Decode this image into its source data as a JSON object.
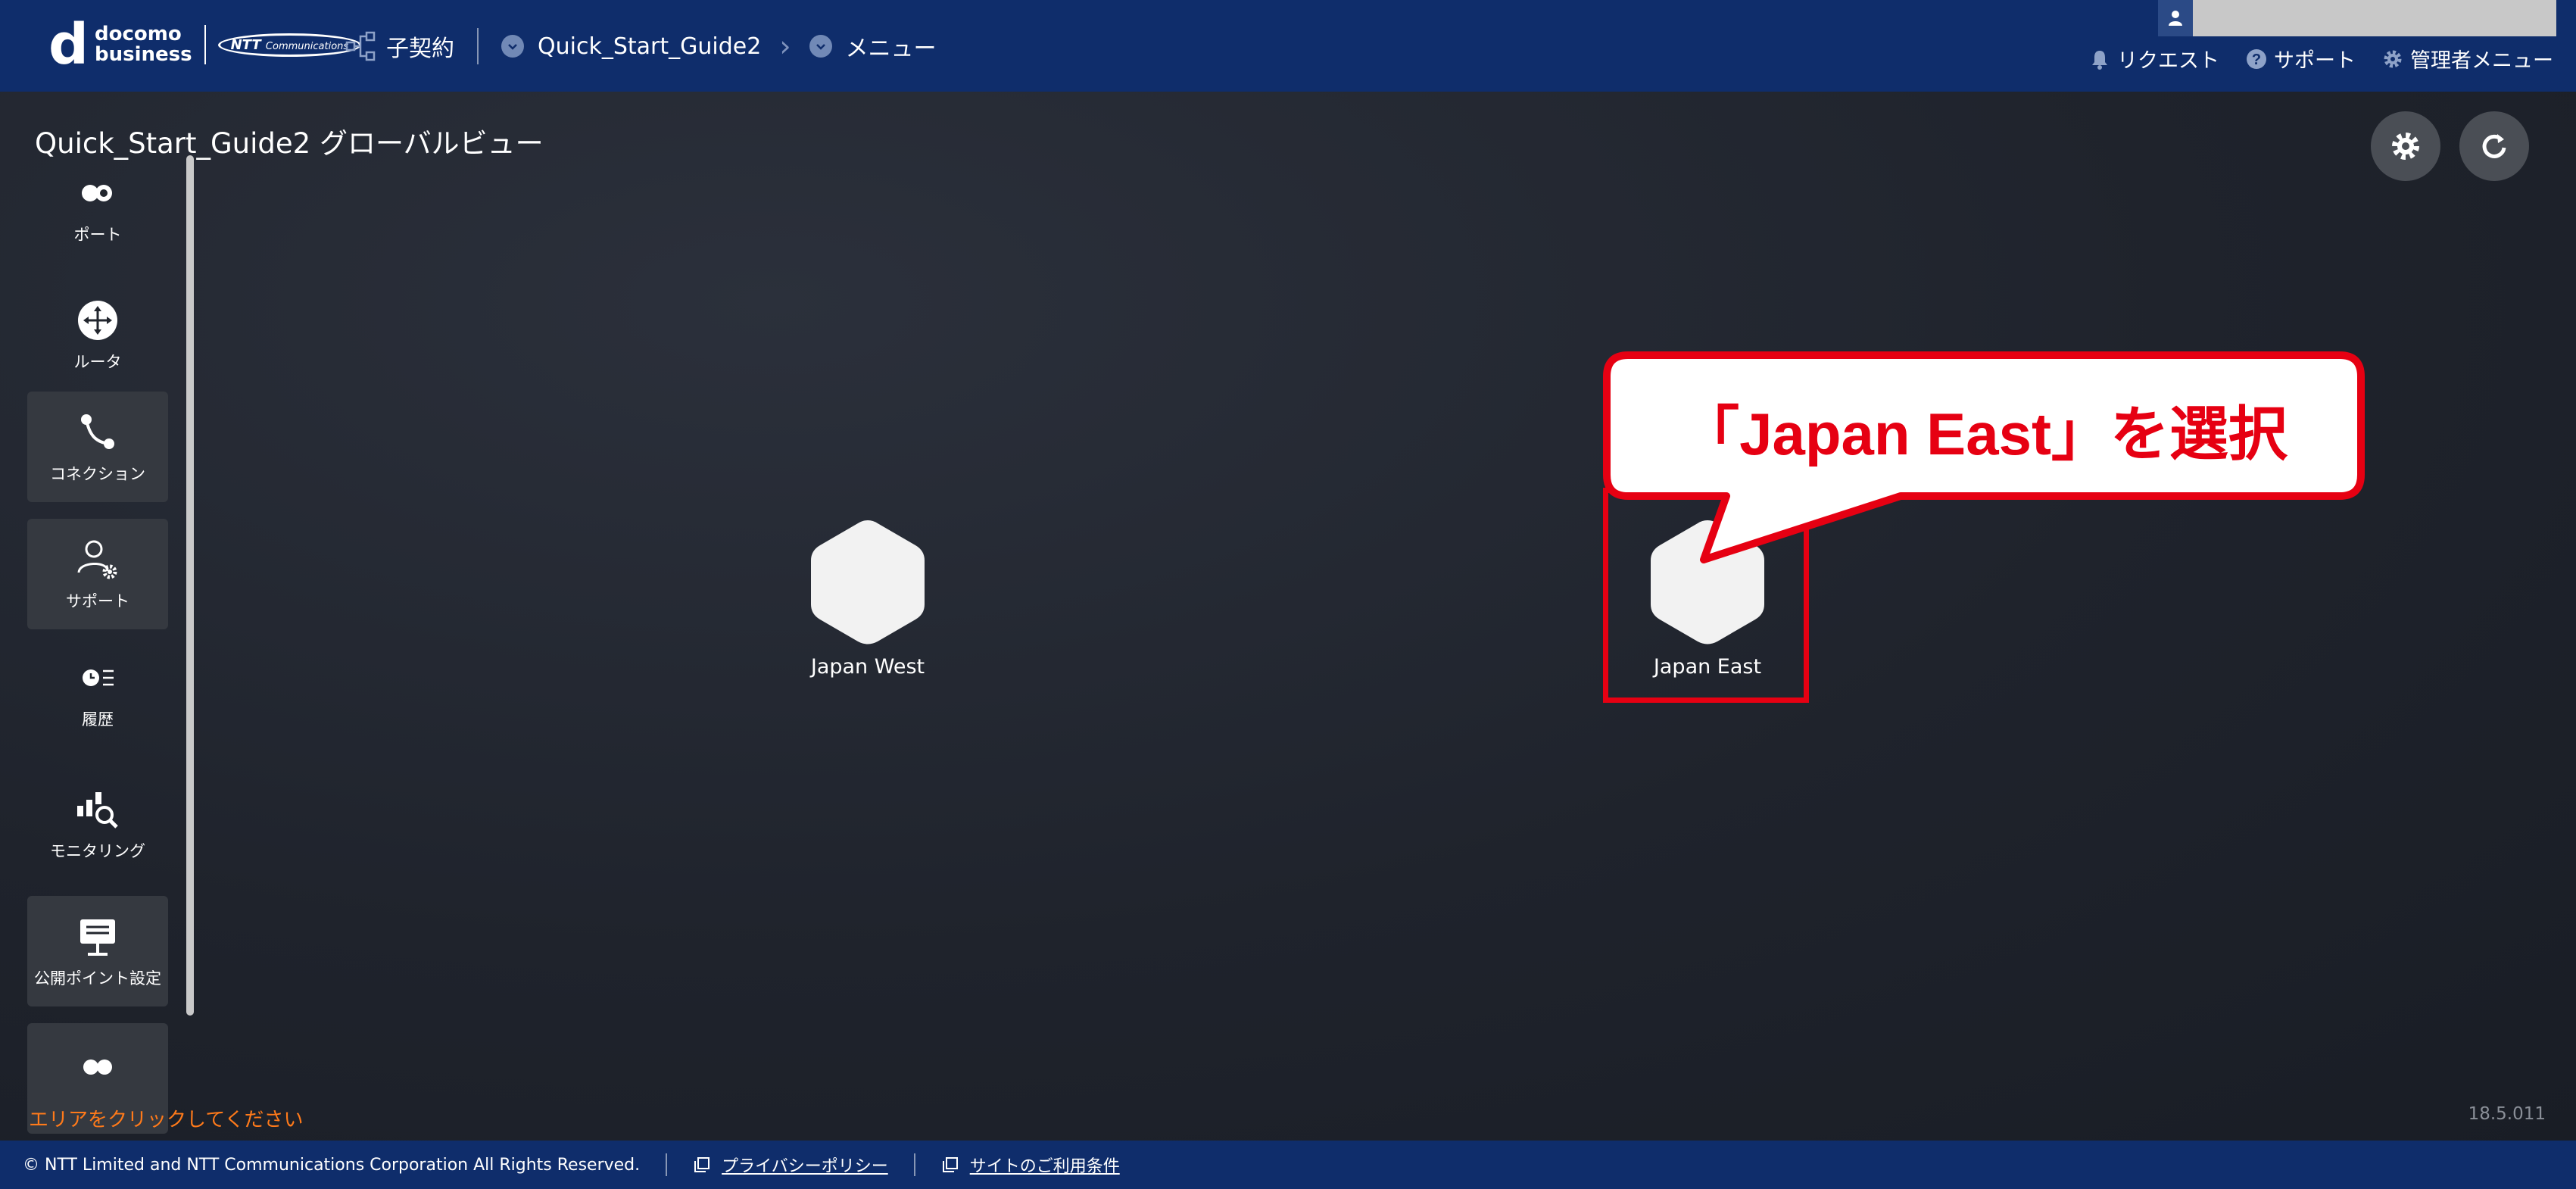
{
  "header": {
    "logo_docomo": "docomo",
    "logo_business": "business",
    "logo_ntt": "NTT",
    "logo_ntt_sub": "Communications",
    "breadcrumb": {
      "contract": "子契約",
      "project": "Quick_Start_Guide2",
      "menu": "メニュー"
    },
    "links": {
      "request": "リクエスト",
      "support": "サポート",
      "admin": "管理者メニュー"
    }
  },
  "main": {
    "title": "Quick_Start_Guide2 グローバルビュー",
    "sidebar": [
      {
        "label": "ポート",
        "icon": "port-icon"
      },
      {
        "label": "ルータ",
        "icon": "router-icon"
      },
      {
        "label": "コネクション",
        "icon": "connection-icon"
      },
      {
        "label": "サポート",
        "icon": "support-icon"
      },
      {
        "label": "履歴",
        "icon": "history-icon"
      },
      {
        "label": "モニタリング",
        "icon": "monitoring-icon"
      },
      {
        "label": "公開ポイント設定",
        "icon": "public-point-icon"
      }
    ],
    "regions": [
      {
        "name": "Japan West"
      },
      {
        "name": "Japan East"
      }
    ],
    "callout": "「Japan East」を選択",
    "hint": "エリアをクリックしてください",
    "version": "18.5.011"
  },
  "footer": {
    "copyright": "© NTT Limited and NTT Communications Corporation All Rights Reserved.",
    "privacy": "プライバシーポリシー",
    "terms": "サイトのご利用条件"
  },
  "colors": {
    "header_bg": "#0f2d6b",
    "highlight": "#e60012",
    "hint": "#ff7a1a"
  }
}
